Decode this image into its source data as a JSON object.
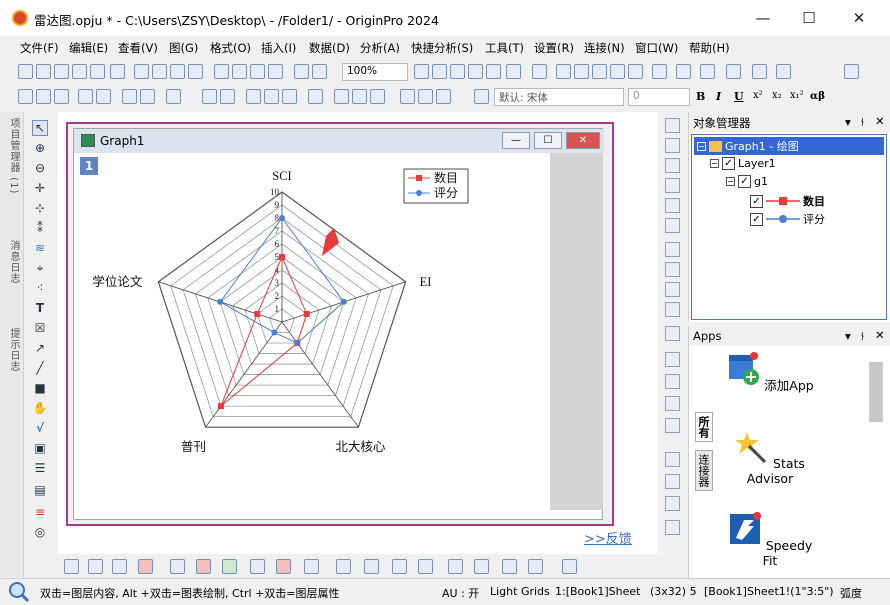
{
  "window": {
    "title": "雷达图.opju * - C:\\Users\\ZSY\\Desktop\\ - /Folder1/ - OriginPro 2024",
    "minimize": "—",
    "maximize": "☐",
    "close": "✕"
  },
  "menu": [
    "文件(F)",
    "编辑(E)",
    "查看(V)",
    "图(G)",
    "格式(O)",
    "插入(I)",
    "数据(D)",
    "分析(A)",
    "快捷分析(S)",
    "工具(T)",
    "设置(R)",
    "连接(N)",
    "窗口(W)",
    "帮助(H)"
  ],
  "toolbar": {
    "zoom": "100%",
    "font_label": "默认: 宋体",
    "font_size": "0",
    "format_buttons": [
      "B",
      "I",
      "U",
      "x²",
      "x₂",
      "x₁²",
      "αβ"
    ]
  },
  "left_dock_tabs": [
    "项目管理器 (1)",
    "消息日志",
    "提示日志"
  ],
  "graph_window": {
    "title": "Graph1",
    "layer_badge": "1",
    "minimize": "—",
    "maximize": "☐",
    "close": "✕"
  },
  "chart_data": {
    "type": "radar",
    "axes": [
      "SCI",
      "EI",
      "北大核心",
      "普刊",
      "学位论文"
    ],
    "range": [
      0,
      10
    ],
    "ticks": [
      "1",
      "2",
      "3",
      "4",
      "5",
      "6",
      "7",
      "8",
      "9",
      "10"
    ],
    "series": [
      {
        "name": "数目",
        "color": "#e8393b",
        "marker": "square",
        "values": [
          5,
          2,
          2,
          8,
          2
        ]
      },
      {
        "name": "评分",
        "color": "#4a7fd8",
        "marker": "circle",
        "values": [
          8,
          5,
          2,
          1,
          5
        ]
      }
    ],
    "legend_position": "top-right",
    "annotation": "red-arrow"
  },
  "feedback_link": ">>反馈",
  "object_manager": {
    "title": "对象管理器",
    "graph": "Graph1 - 绘图",
    "layer": "Layer1",
    "group": "g1",
    "items": [
      "数目",
      "评分"
    ]
  },
  "apps": {
    "title": "Apps",
    "tabs": [
      "所有",
      "连接器"
    ],
    "items": [
      "添加App",
      "Stats Advisor",
      "Speedy Fit"
    ]
  },
  "status": {
    "hint": "双击=图层内容, Alt +双击=图表绘制, Ctrl +双击=图层属性",
    "au": "AU : 开",
    "grids": "Light Grids",
    "book": "1:[Book1]Sheet",
    "dims": "(3x32) 5",
    "ref": "[Book1]Sheet1!(1\"3:5\")",
    "unit": "弧度"
  }
}
